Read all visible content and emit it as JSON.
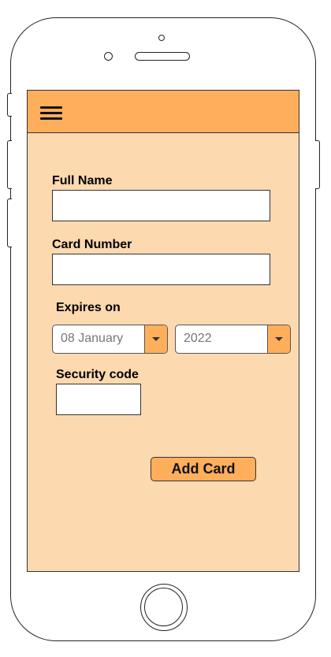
{
  "form": {
    "full_name": {
      "label": "Full Name",
      "value": ""
    },
    "card_number": {
      "label": "Card Number",
      "value": ""
    },
    "expires": {
      "label": "Expires on",
      "day_month_value": "08 January",
      "year_value": "2022"
    },
    "security_code": {
      "label": "Security code",
      "value": ""
    },
    "submit_label": "Add Card"
  },
  "colors": {
    "header": "#ffae5c",
    "background": "#fdd9b0"
  },
  "icons": {
    "menu": "hamburger-menu-icon",
    "dropdown": "chevron-down-icon"
  }
}
